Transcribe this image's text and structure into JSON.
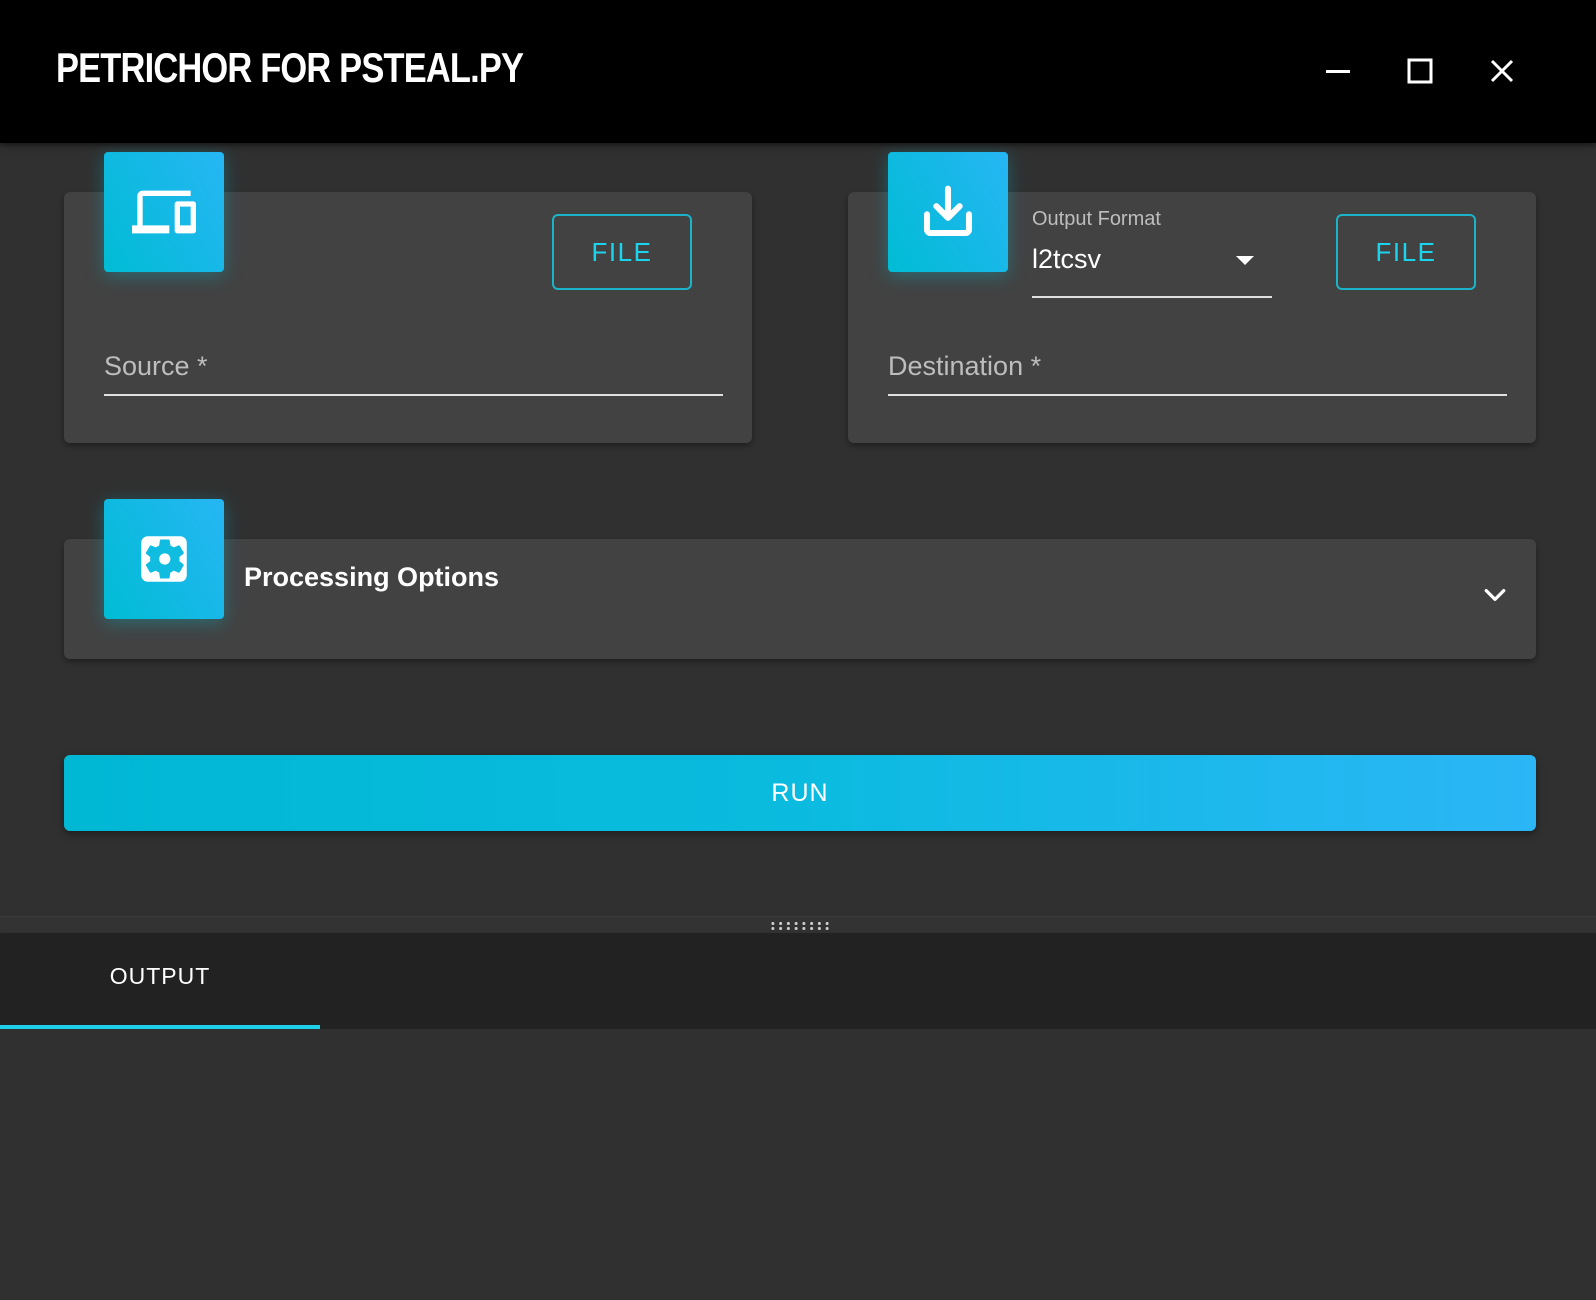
{
  "window": {
    "title": "PETRICHOR FOR PSTEAL.PY",
    "controls": [
      "minimize-icon",
      "maximize-icon",
      "close-icon"
    ]
  },
  "source_card": {
    "icon": "devices-icon",
    "file_button": "FILE",
    "source_label": "Source *"
  },
  "destination_card": {
    "icon": "download-icon",
    "output_format_label": "Output Format",
    "output_format_value": "l2tcsv",
    "file_button": "FILE",
    "destination_label": "Destination *"
  },
  "processing": {
    "icon": "settings-icon",
    "title": "Processing Options"
  },
  "run_button": "RUN",
  "output_panel": {
    "tabs": [
      {
        "label": "OUTPUT",
        "active": true
      }
    ]
  },
  "colors": {
    "accent": "#00bcd4",
    "accent_light": "#26b6f4",
    "background": "#303030",
    "card": "#424242",
    "titlebar": "#000000"
  }
}
